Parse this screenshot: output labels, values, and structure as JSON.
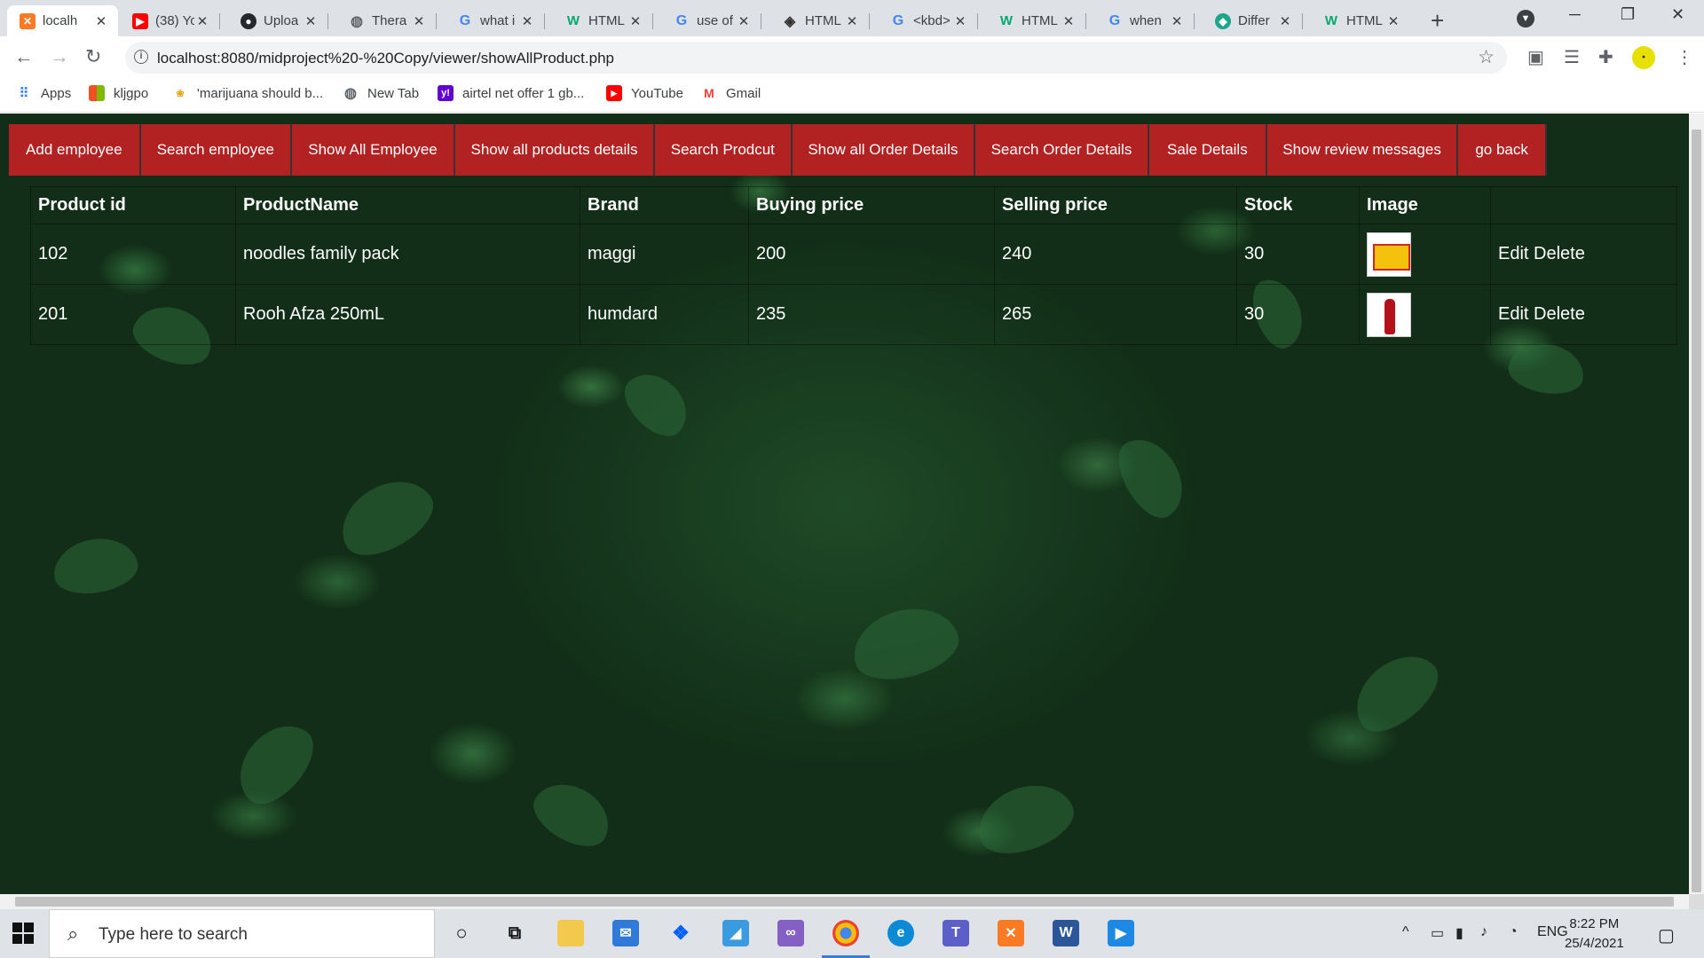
{
  "browser": {
    "tabs": [
      {
        "label": "localh",
        "icon": "xampp-icon",
        "color": "#fb7a24",
        "active": true
      },
      {
        "label": "(38) Yo",
        "icon": "youtube-icon",
        "color": "#ff0000"
      },
      {
        "label": "Uploa",
        "icon": "github-icon",
        "color": "#24292e"
      },
      {
        "label": "Thera",
        "icon": "globe-icon",
        "color": "#5f6368"
      },
      {
        "label": "what i",
        "icon": "google-icon",
        "color": "#4285f4"
      },
      {
        "label": "HTML",
        "icon": "w3schools-icon",
        "color": "#04aa6d"
      },
      {
        "label": "use of",
        "icon": "google-icon",
        "color": "#4285f4"
      },
      {
        "label": "HTML",
        "icon": "diamond-icon",
        "color": "#333333"
      },
      {
        "label": "<kbd>",
        "icon": "google-icon",
        "color": "#4285f4"
      },
      {
        "label": "HTML",
        "icon": "w3schools-icon",
        "color": "#04aa6d"
      },
      {
        "label": "when",
        "icon": "google-icon",
        "color": "#4285f4"
      },
      {
        "label": "Differ",
        "icon": "shield-icon",
        "color": "#1da58a"
      },
      {
        "label": "HTML",
        "icon": "w3schools-icon",
        "color": "#04aa6d"
      }
    ],
    "url": "localhost:8080/midproject%20-%20Copy/viewer/showAllProduct.php",
    "bookmarks": [
      {
        "label": "Apps",
        "icon": "apps-grid-icon",
        "color": "#4285f4"
      },
      {
        "label": "kljgpo",
        "icon": "microsoft-icon",
        "color": "#f25022"
      },
      {
        "label": "'marijuana should b...",
        "icon": "bookmark-favicon-icon",
        "color": "#e8a317"
      },
      {
        "label": "New Tab",
        "icon": "globe-icon",
        "color": "#5f6368"
      },
      {
        "label": "airtel net offer 1 gb...",
        "icon": "yahoo-icon",
        "color": "#6001d2"
      },
      {
        "label": "YouTube",
        "icon": "youtube-icon",
        "color": "#ff0000"
      },
      {
        "label": "Gmail",
        "icon": "gmail-icon",
        "color": "#ea4335"
      }
    ]
  },
  "page": {
    "nav": [
      "Add employee",
      "Search employee",
      "Show All Employee",
      "Show all products details",
      "Search Prodcut",
      "Show all Order Details",
      "Search Order Details",
      "Sale Details",
      "Show review messages",
      "go back"
    ],
    "nav_color": "#b22222",
    "table": {
      "headers": [
        "Product id",
        "ProductName",
        "Brand",
        "Buying price",
        "Selling price",
        "Stock",
        "Image",
        ""
      ],
      "rows": [
        {
          "id": "102",
          "name": "noodles family pack",
          "brand": "maggi",
          "buying": "200",
          "selling": "240",
          "stock": "30",
          "image": "noodles-product-image",
          "actions": "Edit Delete"
        },
        {
          "id": "201",
          "name": "Rooh Afza 250mL",
          "brand": "humdard",
          "buying": "235",
          "selling": "265",
          "stock": "30",
          "image": "bottle-product-image",
          "actions": "Edit Delete"
        }
      ]
    }
  },
  "taskbar": {
    "search_placeholder": "Type here to search",
    "lang": "ENG",
    "time": "8:22 PM",
    "date": "25/4/2021"
  }
}
